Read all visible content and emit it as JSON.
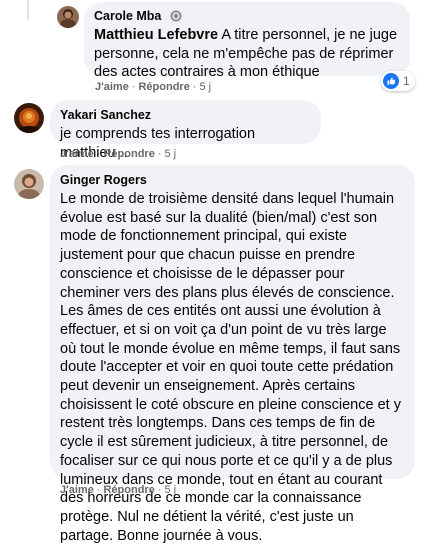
{
  "comments": [
    {
      "author": "Carole Mba",
      "mention": "Matthieu Lefebvre",
      "text": " A titre personnel, je ne juge personne, cela ne m'empêche pas de réprimer des actes contraires à mon éthique",
      "actions": {
        "like": "J'aime",
        "reply": "Répondre",
        "time": "5 j"
      },
      "reaction_count": "1"
    },
    {
      "author": "Yakari Sanchez",
      "text": "je comprends tes interrogation matthieu ..",
      "actions": {
        "like": "J'aime",
        "reply": "Répondre",
        "time": "5 j"
      }
    },
    {
      "author": "Ginger Rogers",
      "text": "Le monde de troisième densité dans lequel l'humain évolue est basé sur la dualité (bien/mal) c'est son mode de fonctionnement principal, qui existe justement pour que chacun puisse en prendre conscience et choisisse de le dépasser pour cheminer vers des plans plus élevés de conscience. Les âmes de ces entités ont aussi une évolution à effectuer, et si on voit ça d'un point de vu très large où tout le monde évolue en même temps, il faut sans doute l'accepter et voir en quoi toute cette prédation peut devenir un enseignement. Après certains choisissent le coté obscure en pleine conscience et y restent très longtemps. Dans ces temps de fin de cycle il est sûrement judicieux, à titre personnel, de focaliser sur ce qui nous porte et ce qu'il y a de plus lumineux dans ce monde, tout en étant au courant des horreurs de ce monde car la connaissance protège. Nul ne détient la vérité, c'est juste un partage. Bonne journée à vous.",
      "actions": {
        "like": "J'aime",
        "reply": "Répondre",
        "time": "5 j"
      }
    }
  ],
  "separator": "·",
  "colors": {
    "bubble": "#f0f2f5",
    "meta": "#65676b",
    "like_blue": "#1877f2"
  }
}
